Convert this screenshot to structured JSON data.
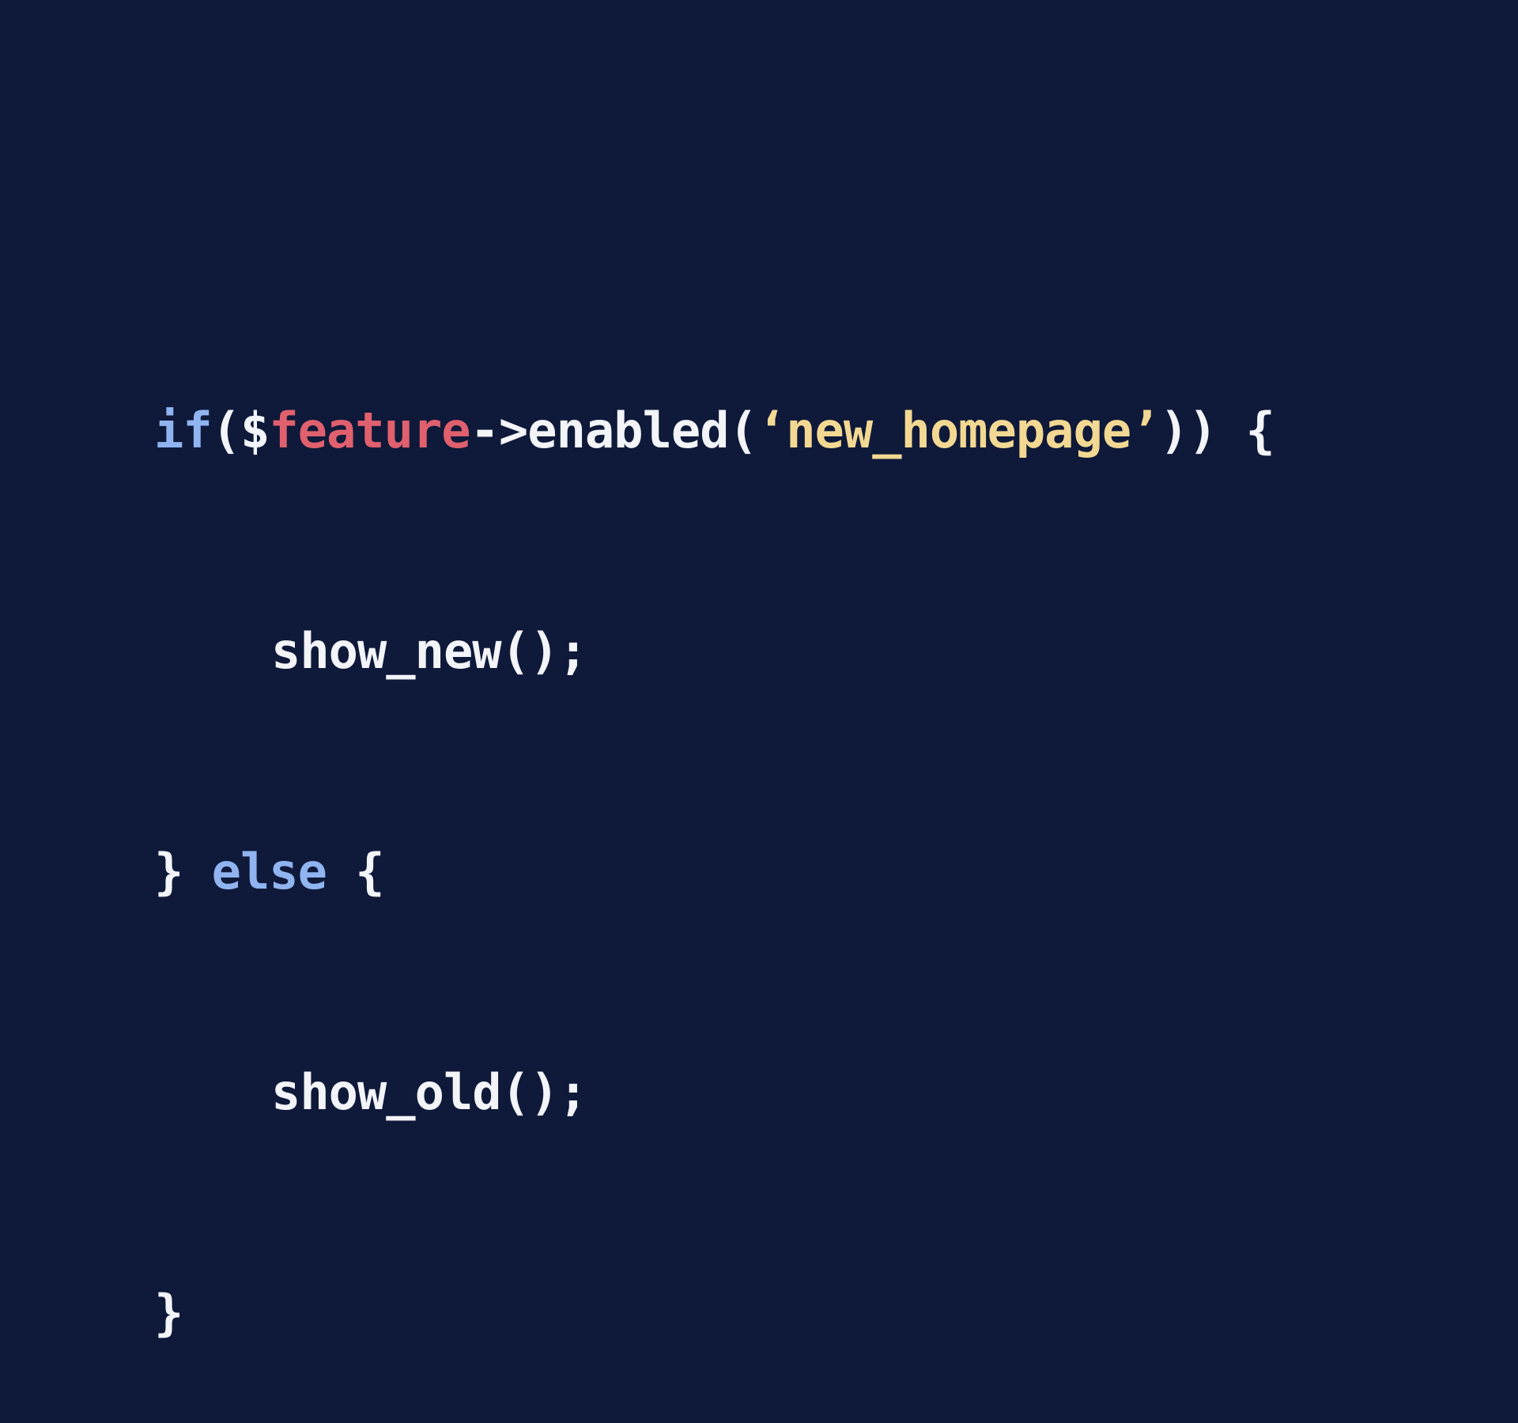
{
  "colors": {
    "background": "#0f1939",
    "keyword": "#8fb4f0",
    "variable": "#e0606e",
    "string": "#f2d892",
    "default": "#f2f4f8"
  },
  "code": {
    "line1": {
      "kw_if": "if",
      "paren_open": "($",
      "variable": "feature",
      "method": "->enabled(",
      "string": "‘new_homepage’",
      "close": ")) {"
    },
    "line2": {
      "call": "show_new();"
    },
    "line3": {
      "brace_close": "} ",
      "kw_else": "else",
      "brace_open": " {"
    },
    "line4": {
      "call": "show_old();"
    },
    "line5": {
      "brace_close": "}"
    }
  }
}
